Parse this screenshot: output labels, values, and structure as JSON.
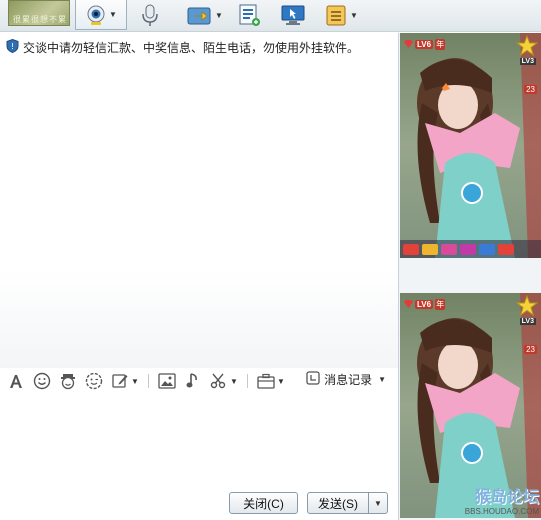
{
  "toolbar": {
    "avatar_caption": "很累很想不累",
    "icons": [
      "webcam-icon",
      "microphone-icon",
      "file-transfer-icon",
      "contact-card-icon",
      "remote-assist-icon",
      "app-menu-icon"
    ]
  },
  "chat": {
    "notice": "交谈中请勿轻信汇款、中奖信息、陌生电话，勿使用外挂软件。"
  },
  "format_toolbar": {
    "history_label": "消息记录"
  },
  "buttons": {
    "close_label": "关闭(C)",
    "send_label": "发送(S)"
  },
  "side_panel": {
    "level_badge": "LV6",
    "year_badge": "年",
    "star_level": "LV3",
    "vip_count": "23",
    "watermark_big": "猴岛论坛",
    "watermark_small": "BBS.HOUDAO.COM"
  },
  "colors": {
    "accent": "#3a7bbf",
    "badge_red": "#c0392b",
    "toolbar_bg": "#e6ecf0"
  }
}
